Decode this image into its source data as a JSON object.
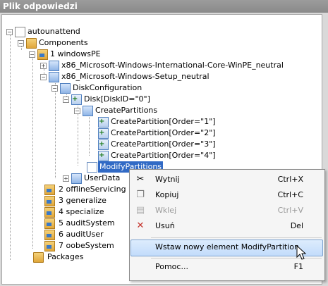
{
  "panel": {
    "title": "Plik odpowiedzi"
  },
  "tree": {
    "root": "autounattend",
    "components": "Components",
    "windowsPE": "1 windowsPE",
    "intlCore": "x86_Microsoft-Windows-International-Core-WinPE_neutral",
    "setup": "x86_Microsoft-Windows-Setup_neutral",
    "diskConfiguration": "DiskConfiguration",
    "disk": "Disk[DiskID=\"0\"]",
    "createPartitions": "CreatePartitions",
    "partitions": [
      "CreatePartition[Order=\"1\"]",
      "CreatePartition[Order=\"2\"]",
      "CreatePartition[Order=\"3\"]",
      "CreatePartition[Order=\"4\"]"
    ],
    "modifyPartitions": "ModifyPartitions",
    "userData": "UserData",
    "passes": [
      "2 offlineServicing",
      "3 generalize",
      "4 specialize",
      "5 auditSystem",
      "6 auditUser",
      "7 oobeSystem"
    ],
    "packages": "Packages"
  },
  "context_menu": {
    "cut": {
      "label": "Wytnij",
      "shortcut": "Ctrl+X",
      "icon": "scissors-icon"
    },
    "copy": {
      "label": "Kopiuj",
      "shortcut": "Ctrl+C",
      "icon": "copy-icon"
    },
    "paste": {
      "label": "Wklej",
      "shortcut": "Ctrl+V",
      "icon": "paste-icon"
    },
    "delete": {
      "label": "Usuń",
      "shortcut": "Del",
      "icon": "delete-x-icon"
    },
    "insert": {
      "label": "Wstaw nowy element ModifyPartition"
    },
    "help": {
      "label": "Pomoc...",
      "shortcut": "F1"
    }
  }
}
